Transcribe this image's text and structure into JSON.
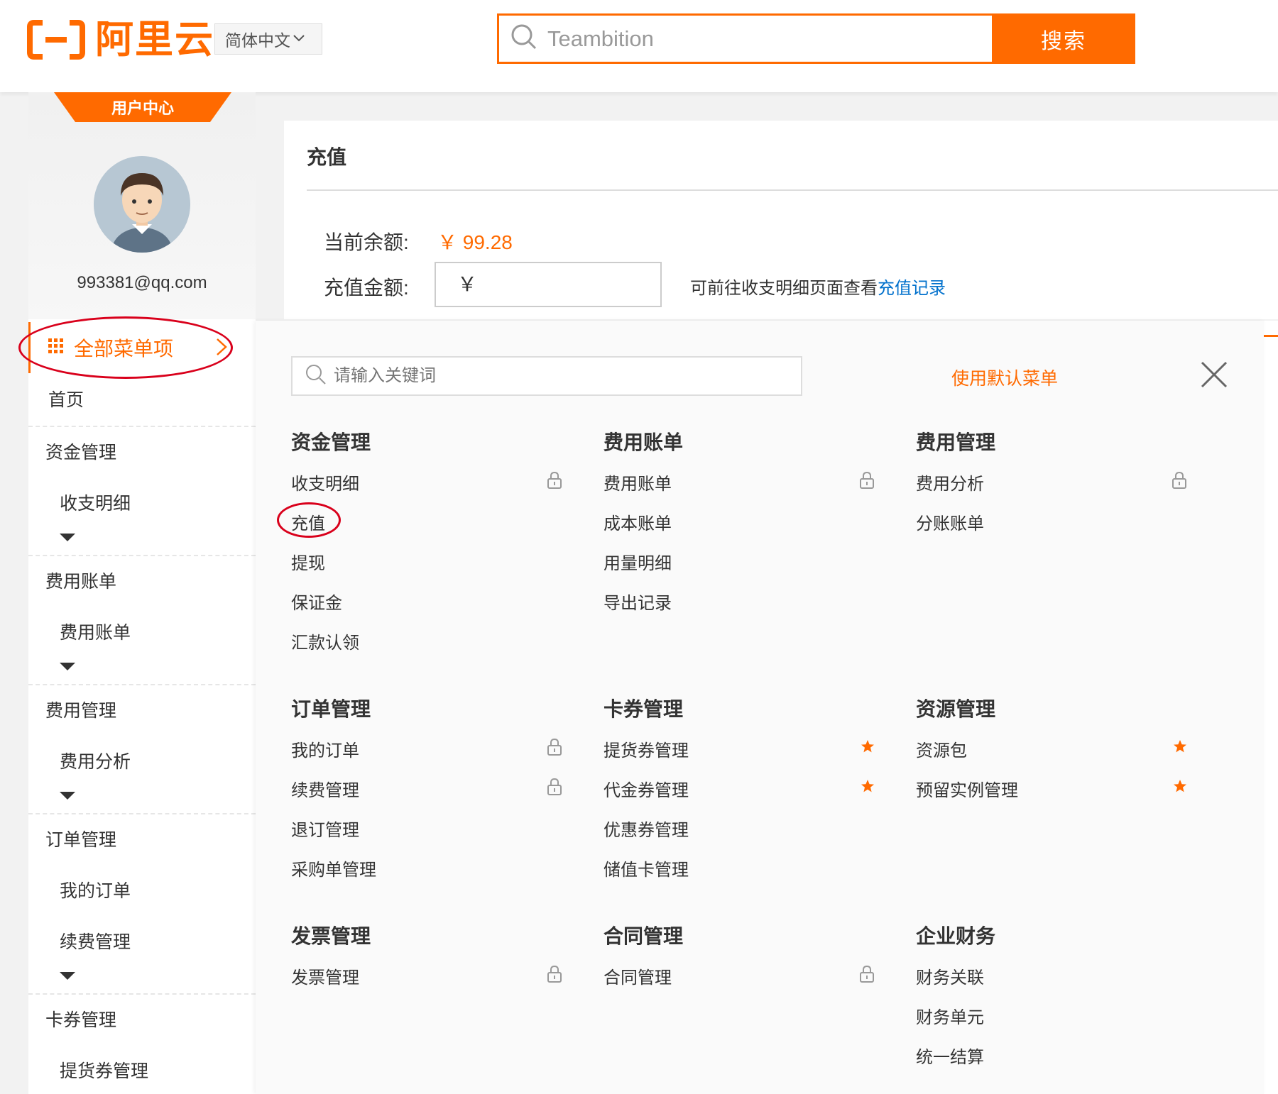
{
  "header": {
    "logo_text": "阿里云",
    "language": "简体中文",
    "search_value": "Teambition",
    "search_button": "搜索"
  },
  "sidebar": {
    "ribbon": "用户中心",
    "email": "993381@qq.com",
    "all_menu_label": "全部菜单项",
    "home": "首页",
    "groups": [
      {
        "title": "资金管理",
        "items": [
          "收支明细"
        ]
      },
      {
        "title": "费用账单",
        "items": [
          "费用账单"
        ]
      },
      {
        "title": "费用管理",
        "items": [
          "费用分析"
        ]
      },
      {
        "title": "订单管理",
        "items": [
          "我的订单",
          "续费管理"
        ]
      },
      {
        "title": "卡券管理",
        "items": [
          "提货券管理"
        ]
      }
    ]
  },
  "content": {
    "page_title": "充值",
    "balance_label": "当前余额:",
    "balance_value": "￥ 99.28",
    "amount_label": "充值金额:",
    "currency_symbol": "￥",
    "hint_text": "可前往收支明细页面查看",
    "hint_link": "充值记录"
  },
  "mega_menu": {
    "search_placeholder": "请输入关键词",
    "use_default": "使用默认菜单",
    "sections": [
      {
        "title": "资金管理",
        "items": [
          {
            "label": "收支明细",
            "mark": "lock"
          },
          {
            "label": "充值",
            "mark": ""
          },
          {
            "label": "提现",
            "mark": ""
          },
          {
            "label": "保证金",
            "mark": ""
          },
          {
            "label": "汇款认领",
            "mark": ""
          }
        ]
      },
      {
        "title": "费用账单",
        "items": [
          {
            "label": "费用账单",
            "mark": "lock"
          },
          {
            "label": "成本账单",
            "mark": ""
          },
          {
            "label": "用量明细",
            "mark": ""
          },
          {
            "label": "导出记录",
            "mark": ""
          }
        ]
      },
      {
        "title": "费用管理",
        "items": [
          {
            "label": "费用分析",
            "mark": "lock"
          },
          {
            "label": "分账账单",
            "mark": ""
          }
        ]
      },
      {
        "title": "订单管理",
        "items": [
          {
            "label": "我的订单",
            "mark": "lock"
          },
          {
            "label": "续费管理",
            "mark": "lock"
          },
          {
            "label": "退订管理",
            "mark": ""
          },
          {
            "label": "采购单管理",
            "mark": ""
          }
        ]
      },
      {
        "title": "卡券管理",
        "items": [
          {
            "label": "提货券管理",
            "mark": "star"
          },
          {
            "label": "代金券管理",
            "mark": "star"
          },
          {
            "label": "优惠券管理",
            "mark": ""
          },
          {
            "label": "储值卡管理",
            "mark": ""
          }
        ]
      },
      {
        "title": "资源管理",
        "items": [
          {
            "label": "资源包",
            "mark": "star"
          },
          {
            "label": "预留实例管理",
            "mark": "star"
          }
        ]
      },
      {
        "title": "发票管理",
        "items": [
          {
            "label": "发票管理",
            "mark": "lock"
          }
        ]
      },
      {
        "title": "合同管理",
        "items": [
          {
            "label": "合同管理",
            "mark": "lock"
          }
        ]
      },
      {
        "title": "企业财务",
        "items": [
          {
            "label": "财务关联",
            "mark": ""
          },
          {
            "label": "财务单元",
            "mark": ""
          },
          {
            "label": "统一结算",
            "mark": ""
          }
        ]
      }
    ]
  },
  "colors": {
    "brand": "#ff6a00",
    "link": "#0070cc",
    "annotation": "#d9001b"
  }
}
